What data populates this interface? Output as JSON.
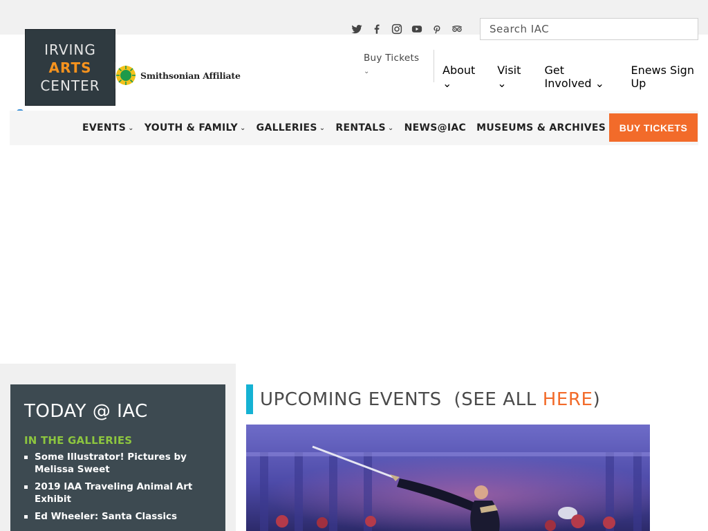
{
  "logo": {
    "line1": "IRVING",
    "line2": "ARTS",
    "line3": "CENTER"
  },
  "affiliate": {
    "label": "Smithsonian Affiliate"
  },
  "social": [
    {
      "icon": "twitter-icon"
    },
    {
      "icon": "facebook-icon"
    },
    {
      "icon": "instagram-icon"
    },
    {
      "icon": "youtube-icon"
    },
    {
      "icon": "pinterest-icon"
    },
    {
      "icon": "tripadvisor-icon"
    }
  ],
  "search": {
    "placeholder": "Search IAC"
  },
  "utility_nav": {
    "buy_tickets": "Buy Tickets",
    "about": "About",
    "visit": "Visit",
    "get_involved": "Get Involved",
    "enews": "Enews Sign Up"
  },
  "main_nav": {
    "events": "EVENTS",
    "youth_family": "YOUTH & FAMILY",
    "galleries": "GALLERIES",
    "rentals": "RENTALS",
    "news": "NEWS@IAC",
    "museums": "MUSEUMS & ARCHIVES",
    "buy_tickets": "BUY TICKETS"
  },
  "today": {
    "title": "TODAY @ IAC",
    "section": "IN THE GALLERIES",
    "items": [
      "Some Illustrator! Pictures by Melissa Sweet",
      "2019 IAA Traveling Animal Art Exhibit",
      "Ed Wheeler: Santa Classics"
    ]
  },
  "upcoming": {
    "prefix": "UPCOMING EVENTS  (SEE ALL ",
    "link": "HERE",
    "suffix": ")"
  },
  "colors": {
    "accent_orange": "#f26b2a",
    "accent_blue": "#15b2d3",
    "accent_green": "#8dc63f",
    "panel_dark": "#3d4a51"
  }
}
